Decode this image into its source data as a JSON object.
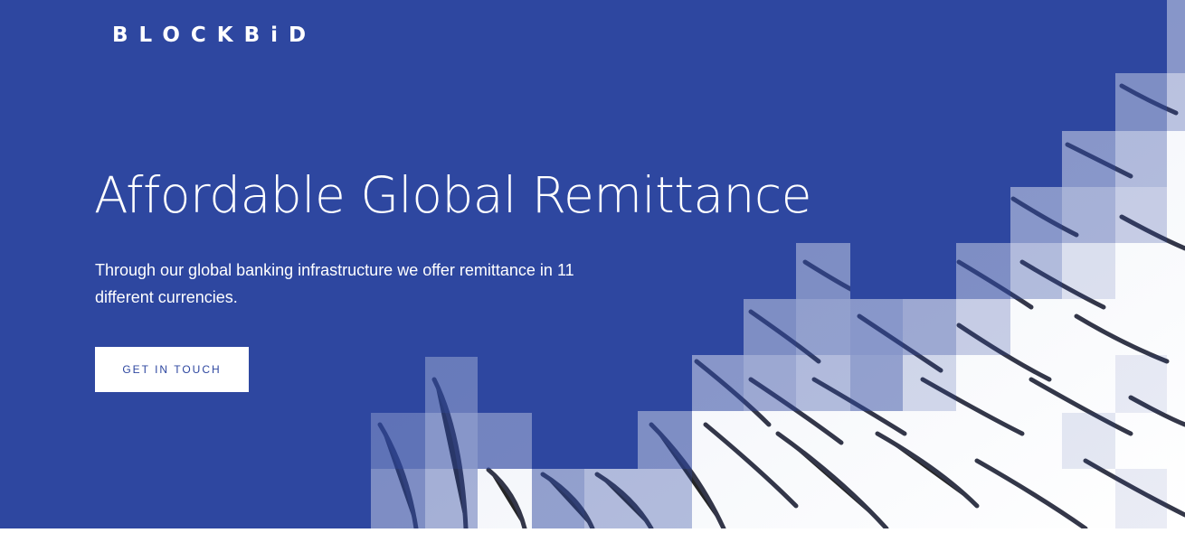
{
  "brand": {
    "logo_text": "BLOCKBiD"
  },
  "hero": {
    "headline": "Affordable Global Remittance",
    "subtext": "Through our global banking infrastructure we offer remittance in 11 different currencies.",
    "cta_label": "GET IN TOUCH"
  },
  "colors": {
    "background": "#2e47a0",
    "text": "#ffffff",
    "button_background": "#ffffff",
    "button_text": "#2e47a0"
  }
}
